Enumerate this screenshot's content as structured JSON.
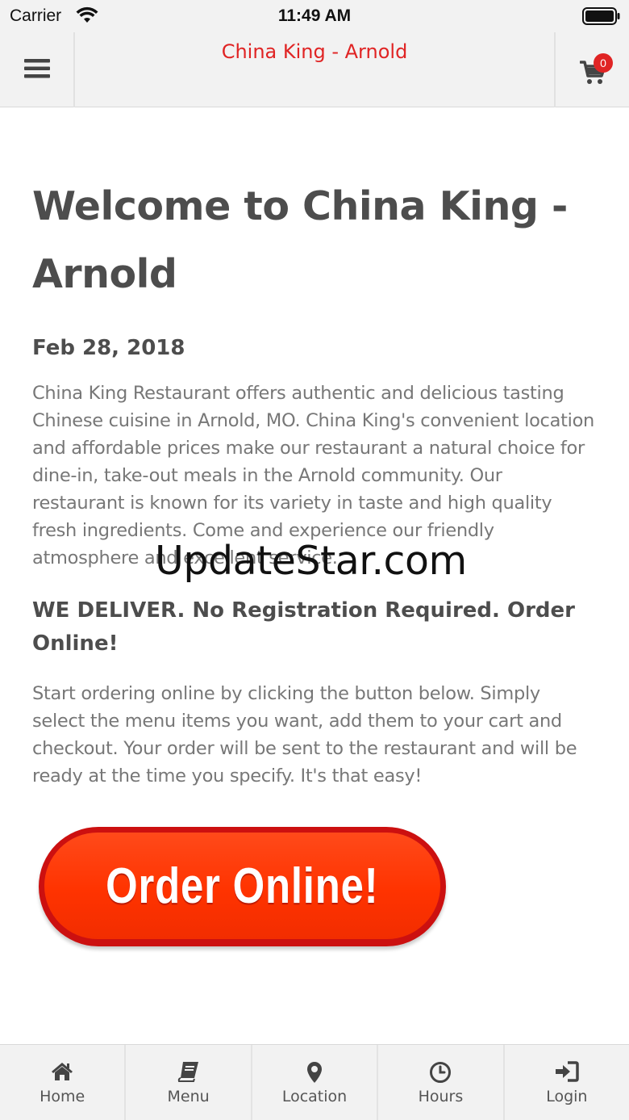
{
  "status_bar": {
    "carrier": "Carrier",
    "time": "11:49 AM"
  },
  "header": {
    "title": "China King - Arnold",
    "menu_icon": "hamburger-icon",
    "cart_icon": "shopping-cart-icon",
    "cart_count": "0"
  },
  "content": {
    "welcome_title": "Welcome to China King - Arnold",
    "date": "Feb 28, 2018",
    "description": "China King Restaurant offers authentic and delicious tasting Chinese cuisine in Arnold, MO.  China King's convenient location and affordable prices make our restaurant a natural choice for dine-in, take-out meals in the Arnold community. Our restaurant is known for its variety in taste and high quality fresh ingredients. Come and experience our friendly atmosphere and excellent service.",
    "deliver_heading": "WE DELIVER. No Registration Required. Order Online!",
    "instructions": "Start ordering online by clicking the button below. Simply select the menu items you want, add them to your cart and checkout. Your order will be sent to the restaurant and will be ready at the time you specify. It's that easy!",
    "order_button_label": "Order Online!"
  },
  "watermark": "UpdateStar.com",
  "bottom_nav": [
    {
      "label": "Home",
      "icon": "home-icon"
    },
    {
      "label": "Menu",
      "icon": "book-icon"
    },
    {
      "label": "Location",
      "icon": "map-marker-icon"
    },
    {
      "label": "Hours",
      "icon": "clock-icon"
    },
    {
      "label": "Login",
      "icon": "sign-in-icon"
    }
  ],
  "colors": {
    "accent": "#e02424",
    "header_bg": "#f2f2f2",
    "order_button": "#ff3300"
  }
}
